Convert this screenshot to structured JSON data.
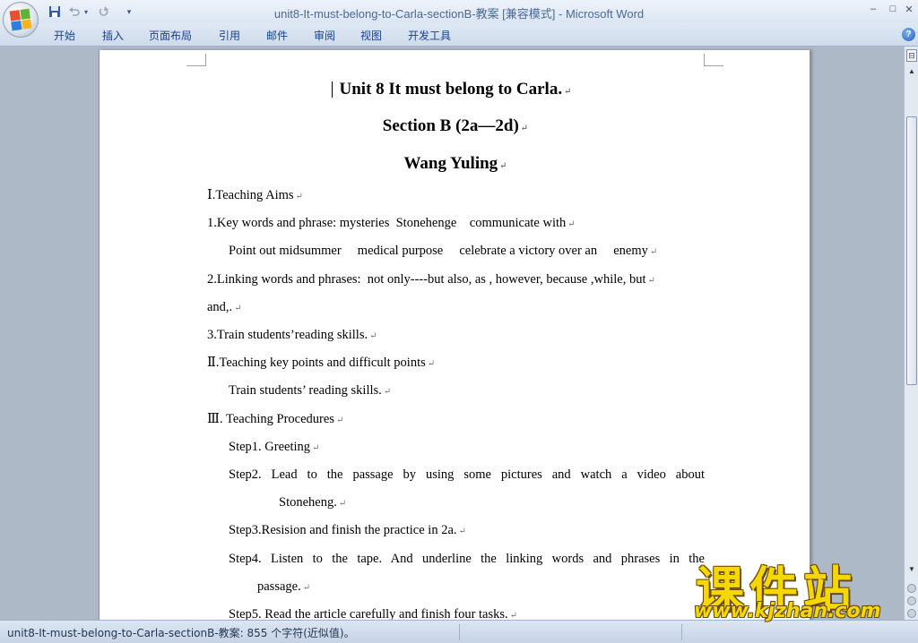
{
  "window": {
    "title": "unit8-It-must-belong-to-Carla-sectionB-教案 [兼容模式] - Microsoft Word",
    "controls": {
      "minimize": "–",
      "maximize": "□",
      "close": "✕"
    }
  },
  "quick_access": {
    "save_icon": "save-icon",
    "undo_icon": "undo-icon",
    "redo_icon": "redo-icon",
    "customize_glyph": "▾"
  },
  "ribbon": {
    "tabs": [
      "开始",
      "插入",
      "页面布局",
      "引用",
      "邮件",
      "审阅",
      "视图",
      "开发工具"
    ],
    "help_glyph": "?"
  },
  "document": {
    "title": "Unit 8 It must belong to Carla.",
    "subtitle": "Section B (2a—2d)",
    "author": "Wang Yuling",
    "paragraph_mark": "↵",
    "lines": [
      "Ⅰ.Teaching Aims",
      "1.Key words and phrase: mysteries  Stonehenge    communicate with",
      "Point out midsummer     medical purpose     celebrate a victory over an     enemy",
      "2.Linking words and phrases:  not only----but also, as , however, because ,while, but",
      "and,.",
      "3.Train students’reading skills.",
      "Ⅱ.Teaching key points and difficult points",
      "Train students’ reading skills.",
      "Ⅲ. Teaching Procedures",
      "Step1. Greeting",
      "Step2. Lead to the passage by using some pictures and watch a video about",
      "Stoneheng.",
      "Step3.Resision and finish the practice in 2a.",
      "Step4. Listen to the tape. And underline the linking words and phrases in the",
      "passage.",
      "Step5. Read the article carefully and finish four tasks."
    ]
  },
  "status_bar": {
    "text": "unit8-It-must-belong-to-Carla-sectionB-教案: 855 个字符(近似值)。"
  },
  "watermark": {
    "chinese": "课件站",
    "url": "www.kjzhan.com"
  },
  "colors": {
    "title_text": "#4a6a95",
    "tab_text": "#15428b",
    "watermark": "#f5d800",
    "workspace": "#aeb9c8"
  }
}
